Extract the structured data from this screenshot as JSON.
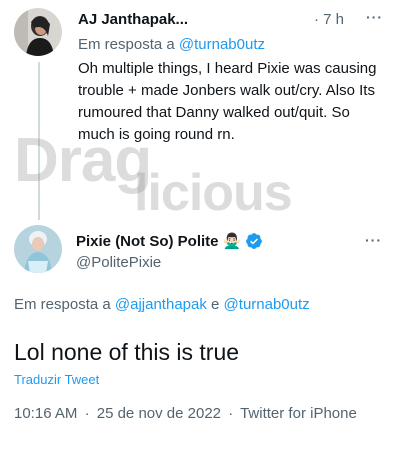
{
  "tweet1": {
    "author_name": "AJ Janthapak...",
    "time": "· 7 h",
    "reply_prefix": "Em resposta a",
    "reply_mention": "@turnab0utz",
    "text": "Oh multiple things, I heard Pixie was causing trouble + made Jonbers walk out/cry. Also Its rumoured that Danny walked out/quit. So much is going round rn.",
    "more_icon": "···"
  },
  "watermark": {
    "line1": "Drag",
    "line2": "licious"
  },
  "tweet2": {
    "author_name": "Pixie (Not So) Polite",
    "emoji": "🙅🏻‍♂️",
    "verified_icon": "verified-badge",
    "handle": "@PolitePixie",
    "more_icon": "···",
    "reply_prefix": "Em resposta a",
    "reply_mention1": "@ajjanthapak",
    "reply_conjunction": "e",
    "reply_mention2": "@turnab0utz",
    "text": "Lol none of this is true",
    "translate_label": "Traduzir Tweet",
    "time": "10:16 AM",
    "date": "25 de nov de 2022",
    "source": "Twitter for iPhone",
    "separator": "·"
  },
  "colors": {
    "link": "#1d9bf0",
    "secondary_text": "#536471",
    "thread_line": "#cfd9de"
  }
}
